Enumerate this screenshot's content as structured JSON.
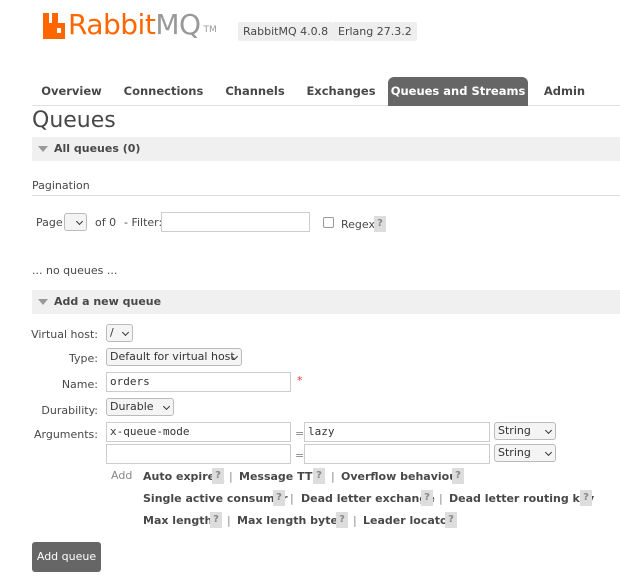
{
  "header": {
    "logo_rabbit": "Rabbit",
    "logo_mq": "MQ",
    "logo_tm": "TM",
    "version_rabbitmq": "RabbitMQ 4.0.8",
    "version_erlang": "Erlang 27.3.2",
    "brand_color": "#ff6600"
  },
  "tabs": [
    {
      "label": "Overview",
      "active": false
    },
    {
      "label": "Connections",
      "active": false
    },
    {
      "label": "Channels",
      "active": false
    },
    {
      "label": "Exchanges",
      "active": false
    },
    {
      "label": "Queues and Streams",
      "active": true
    },
    {
      "label": "Admin",
      "active": false
    }
  ],
  "page_title": "Queues",
  "all_queues": {
    "title": "All queues (0)",
    "pagination_label": "Pagination",
    "page_label": "Page",
    "of_label": "of 0",
    "filter_label": "- Filter:",
    "filter_value": "",
    "regex_label": "Regex",
    "regex_checked": false,
    "help": "?",
    "empty_text": "... no queues ..."
  },
  "add_queue": {
    "title": "Add a new queue",
    "virtual_host_label": "Virtual host:",
    "virtual_host_value": "/",
    "type_label": "Type:",
    "type_value": "Default for virtual host",
    "name_label": "Name:",
    "name_value": "orders",
    "required_mark": "*",
    "durability_label": "Durability:",
    "durability_value": "Durable",
    "arguments_label": "Arguments:",
    "arguments": [
      {
        "key": "x-queue-mode",
        "eq": "=",
        "value": "lazy",
        "type": "String"
      },
      {
        "key": "",
        "eq": "=",
        "value": "",
        "type": "String"
      }
    ],
    "add_label": "Add",
    "arg_links": [
      {
        "label": "Auto expire"
      },
      {
        "label": "Message TTL"
      },
      {
        "label": "Overflow behaviour"
      },
      {
        "label": "Single active consumer"
      },
      {
        "label": "Dead letter exchange"
      },
      {
        "label": "Dead letter routing key"
      },
      {
        "label": "Max length"
      },
      {
        "label": "Max length bytes"
      },
      {
        "label": "Leader locator"
      }
    ],
    "separator": "|",
    "submit_label": "Add queue"
  }
}
